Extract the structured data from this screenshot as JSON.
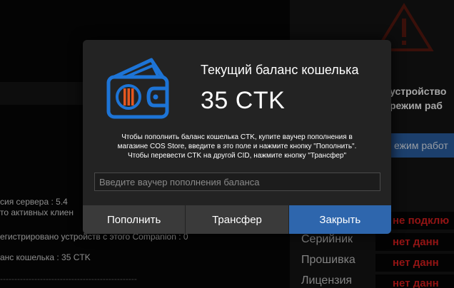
{
  "background": {
    "status_lines": [
      "устройство",
      "режим раб"
    ],
    "status_button_label": "ежим работ",
    "info_lines": [
      "сия сервера : 5.4",
      "то активных клиен",
      "егистрировано устройств с этого Companion : 0",
      "анс кошелька : 35 CTK",
      "------------------------------------------------"
    ],
    "params": [
      {
        "label": "",
        "value": "не подклю"
      },
      {
        "label": "Серийник",
        "value": "нет данн"
      },
      {
        "label": "Прошивка",
        "value": "нет данн"
      },
      {
        "label": "Лицензия",
        "value": "нет данн"
      }
    ]
  },
  "modal": {
    "icon": "wallet-icon",
    "title": "Текущий баланс кошелька",
    "balance": "35 CTK",
    "description": [
      "Чтобы пополнить баланс кошелька CTK, купите ваучер пополнения в",
      "магазине COS Store, введите в это поле и нажмите кнопку \"Пополнить\".",
      "Чтобы перевести CTK на другой CID, нажмите кнопку \"Трансфер\""
    ],
    "voucher_placeholder": "Введите ваучер пополнения баланса",
    "buttons": {
      "topup": "Пополнить",
      "transfer": "Трансфер",
      "close": "Закрыть"
    }
  },
  "colors": {
    "accent": "#2e66ad",
    "icon_blue": "#1d74d6",
    "icon_orange": "#e5571f",
    "error_red": "#e02020",
    "warning_dark": "#5a1a10"
  }
}
